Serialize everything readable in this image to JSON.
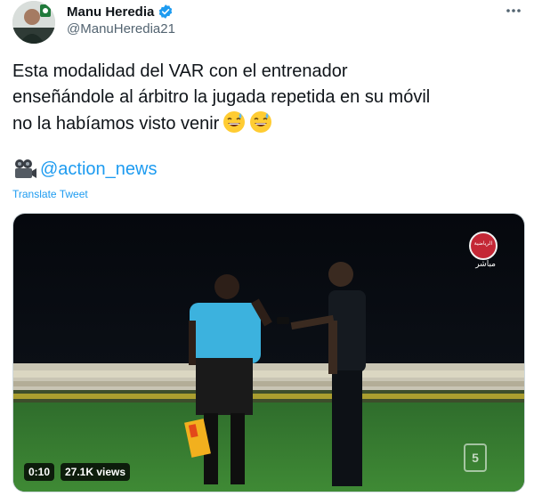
{
  "author": {
    "display_name": "Manu Heredia",
    "handle": "@ManuHeredia21"
  },
  "more_icon": "more-horizontal-icon",
  "tweet": {
    "lines": [
      "Esta modalidad del VAR con el entrenador",
      "enseñándole al árbitro la jugada repetida en su móvil",
      "no la habíamos visto venir"
    ],
    "emojis": [
      "sweat-smile-emoji",
      "sweat-smile-emoji"
    ],
    "mention_icon": "movie-camera-icon",
    "mention": "@action_news",
    "translate_label": "Translate Tweet"
  },
  "video": {
    "time": "0:10",
    "views": "27.1K views",
    "channel_badge_text": "الرياضية",
    "live_label": "مباشر",
    "league_logo_text": "5"
  },
  "colors": {
    "link": "#1d9bf0",
    "secondary_text": "#536471",
    "verified": "#1d9bf0"
  }
}
